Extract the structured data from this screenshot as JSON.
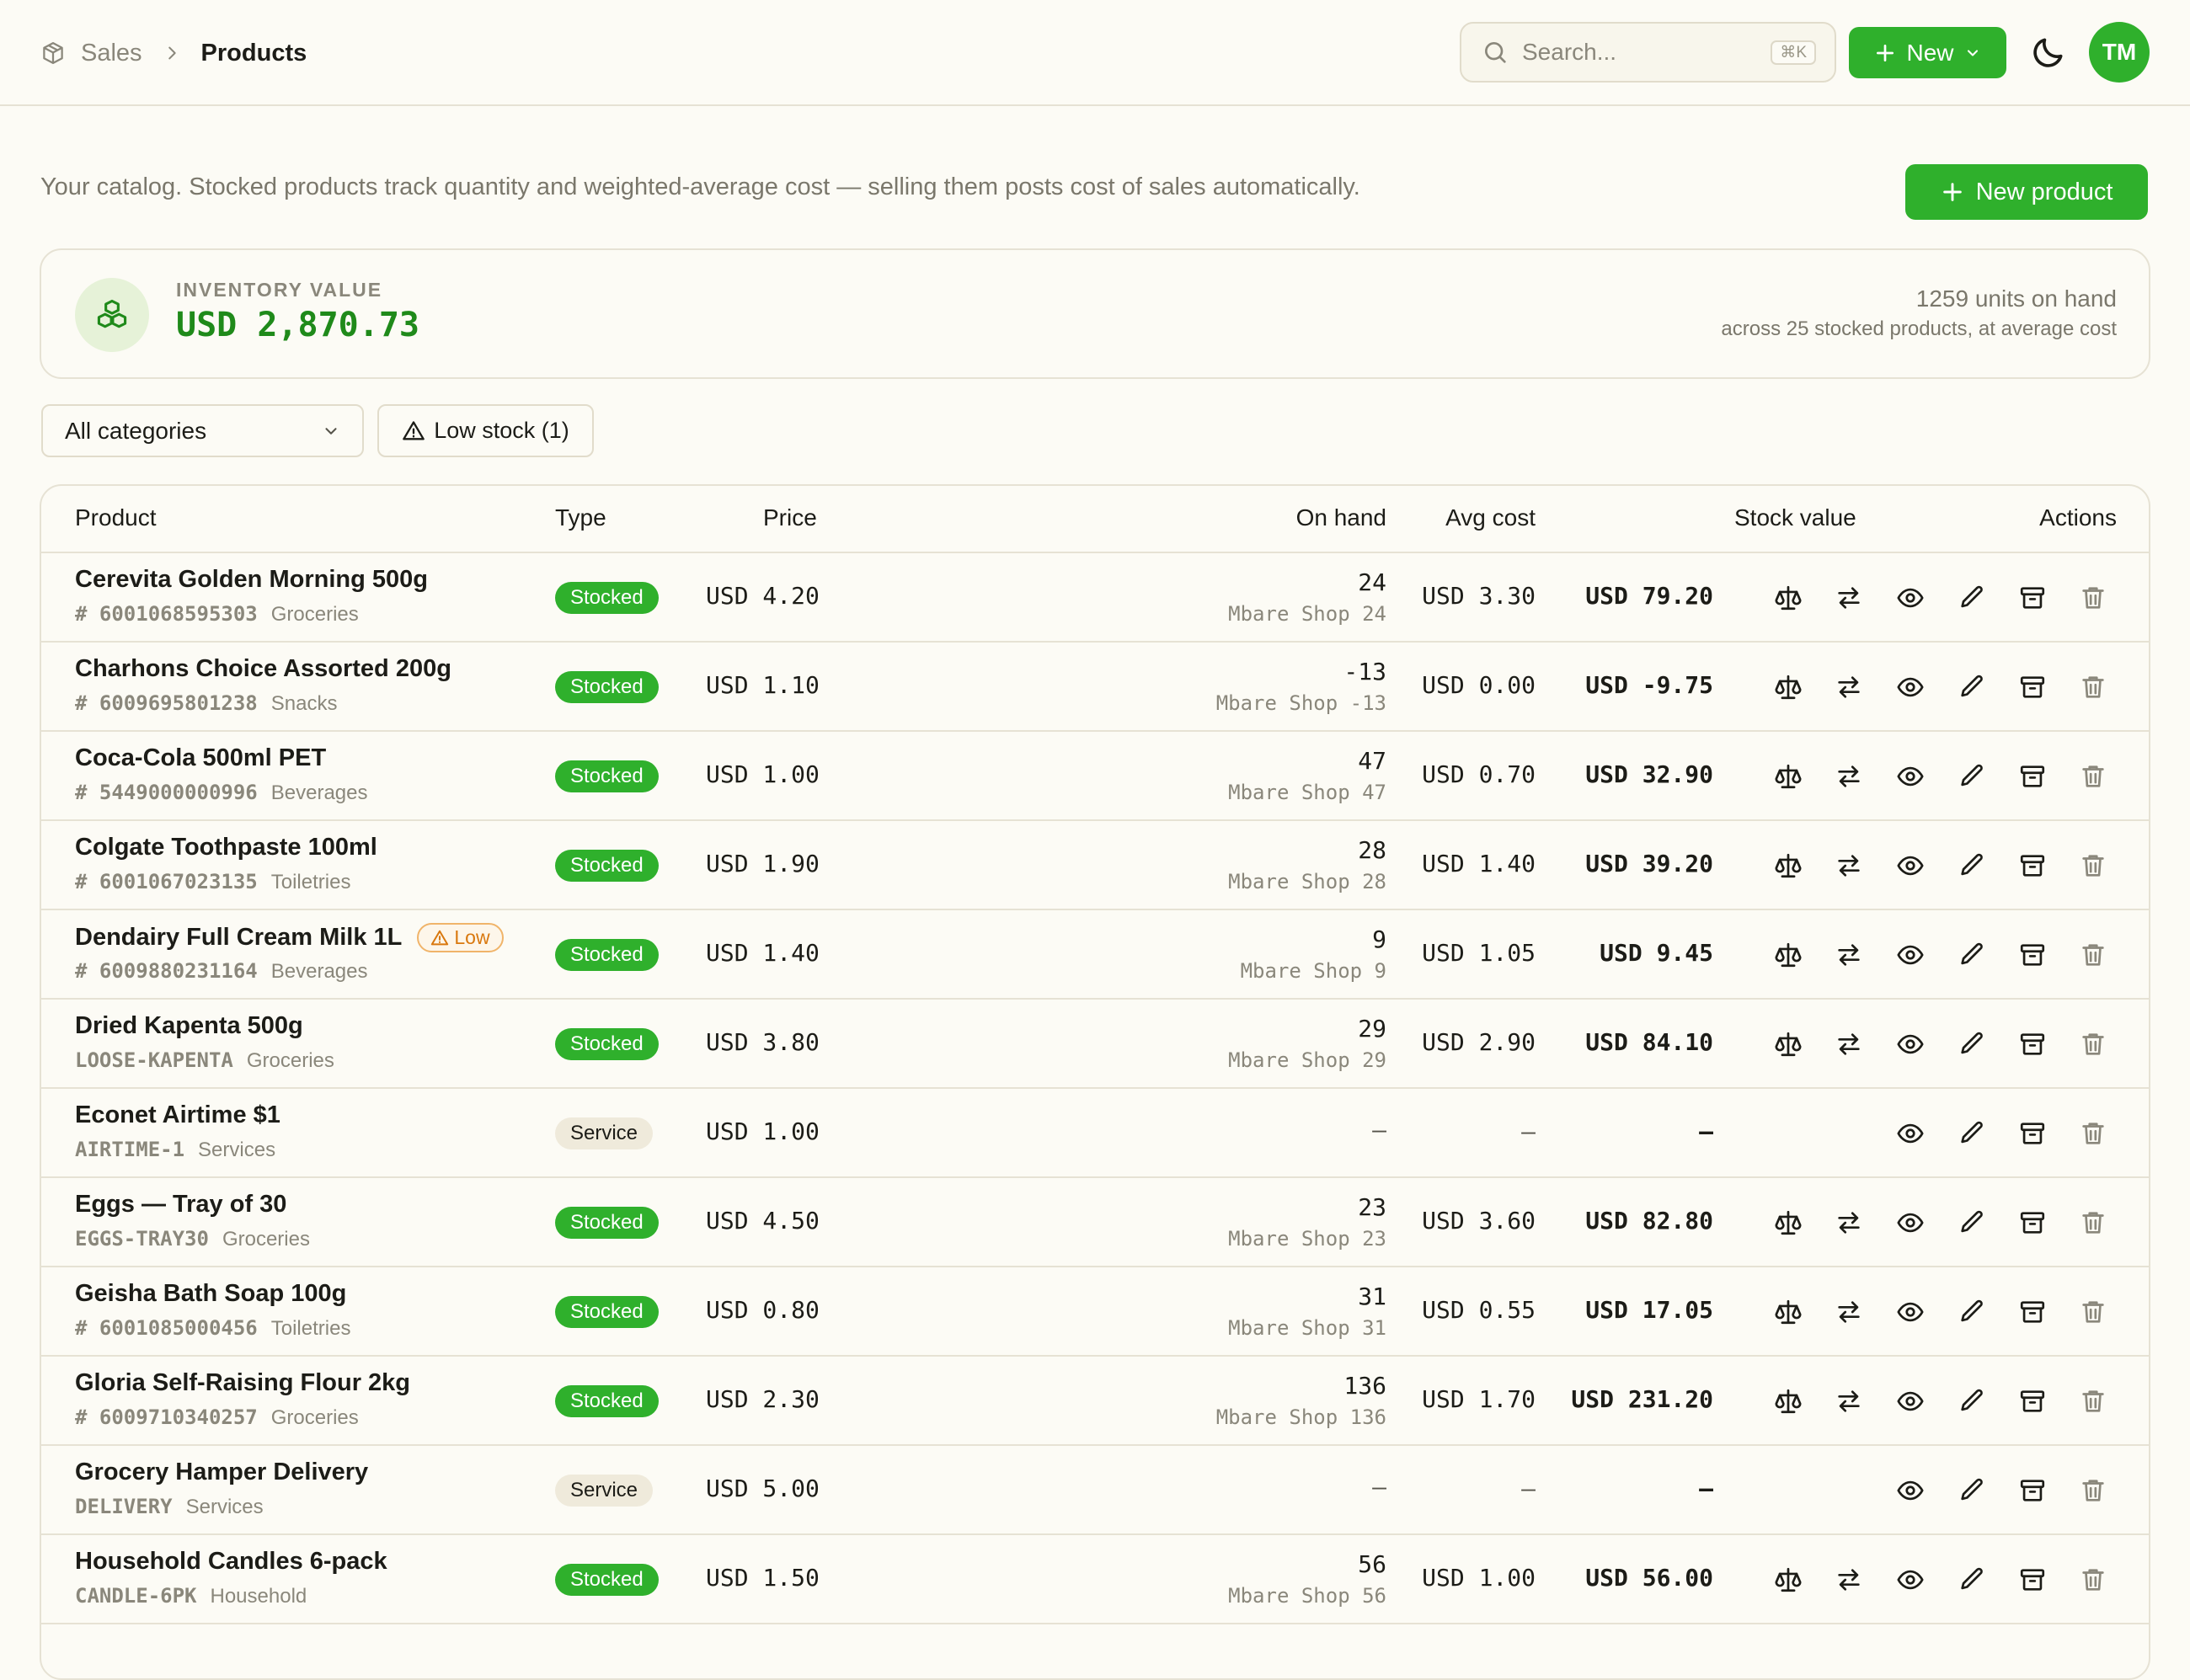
{
  "header": {
    "breadcrumb_root": "Sales",
    "breadcrumb_current": "Products",
    "search_placeholder": "Search...",
    "search_shortcut": "⌘K",
    "new_label": "New",
    "avatar_initials": "TM"
  },
  "intro_text": "Your catalog. Stocked products track quantity and weighted-average cost — selling them posts cost of sales automatically.",
  "new_product_label": "New product",
  "inventory": {
    "label": "INVENTORY VALUE",
    "value": "USD 2,870.73",
    "units": "1259 units on hand",
    "subtitle": "across 25 stocked products, at average cost"
  },
  "filters": {
    "category_value": "All categories",
    "low_stock_label": "Low stock (1)"
  },
  "columns": {
    "product": "Product",
    "type": "Type",
    "price": "Price",
    "on_hand": "On hand",
    "avg_cost": "Avg cost",
    "stock_value": "Stock value",
    "actions": "Actions"
  },
  "rows": [
    {
      "name": "Cerevita Golden Morning 500g",
      "code_prefix": "# ",
      "code": "6001068595303",
      "category": "Groceries",
      "type": "Stocked",
      "price": "USD 4.20",
      "on_hand": "24",
      "location": "Mbare Shop 24",
      "avg_cost": "USD 3.30",
      "stock_value": "USD 79.20"
    },
    {
      "name": "Charhons Choice Assorted 200g",
      "code_prefix": "# ",
      "code": "6009695801238",
      "category": "Snacks",
      "type": "Stocked",
      "price": "USD 1.10",
      "on_hand": "-13",
      "location": "Mbare Shop -13",
      "avg_cost": "USD 0.00",
      "stock_value": "USD -9.75"
    },
    {
      "name": "Coca-Cola 500ml PET",
      "code_prefix": "# ",
      "code": "5449000000996",
      "category": "Beverages",
      "type": "Stocked",
      "price": "USD 1.00",
      "on_hand": "47",
      "location": "Mbare Shop 47",
      "avg_cost": "USD 0.70",
      "stock_value": "USD 32.90"
    },
    {
      "name": "Colgate Toothpaste 100ml",
      "code_prefix": "# ",
      "code": "6001067023135",
      "category": "Toiletries",
      "type": "Stocked",
      "price": "USD 1.90",
      "on_hand": "28",
      "location": "Mbare Shop 28",
      "avg_cost": "USD 1.40",
      "stock_value": "USD 39.20"
    },
    {
      "name": "Dendairy Full Cream Milk 1L",
      "low_label": "Low",
      "code_prefix": "# ",
      "code": "6009880231164",
      "category": "Beverages",
      "type": "Stocked",
      "price": "USD 1.40",
      "on_hand": "9",
      "location": "Mbare Shop 9",
      "avg_cost": "USD 1.05",
      "stock_value": "USD 9.45"
    },
    {
      "name": "Dried Kapenta 500g",
      "code_prefix": "",
      "code": "LOOSE-KAPENTA",
      "category": "Groceries",
      "type": "Stocked",
      "price": "USD 3.80",
      "on_hand": "29",
      "location": "Mbare Shop 29",
      "avg_cost": "USD 2.90",
      "stock_value": "USD 84.10"
    },
    {
      "name": "Econet Airtime $1",
      "code_prefix": "",
      "code": "AIRTIME-1",
      "category": "Services",
      "type": "Service",
      "price": "USD 1.00",
      "on_hand": "–",
      "location": "",
      "avg_cost": "–",
      "stock_value": "–"
    },
    {
      "name": "Eggs — Tray of 30",
      "code_prefix": "",
      "code": "EGGS-TRAY30",
      "category": "Groceries",
      "type": "Stocked",
      "price": "USD 4.50",
      "on_hand": "23",
      "location": "Mbare Shop 23",
      "avg_cost": "USD 3.60",
      "stock_value": "USD 82.80"
    },
    {
      "name": "Geisha Bath Soap 100g",
      "code_prefix": "# ",
      "code": "6001085000456",
      "category": "Toiletries",
      "type": "Stocked",
      "price": "USD 0.80",
      "on_hand": "31",
      "location": "Mbare Shop 31",
      "avg_cost": "USD 0.55",
      "stock_value": "USD 17.05"
    },
    {
      "name": "Gloria Self-Raising Flour 2kg",
      "code_prefix": "# ",
      "code": "6009710340257",
      "category": "Groceries",
      "type": "Stocked",
      "price": "USD 2.30",
      "on_hand": "136",
      "location": "Mbare Shop 136",
      "avg_cost": "USD 1.70",
      "stock_value": "USD 231.20"
    },
    {
      "name": "Grocery Hamper Delivery",
      "code_prefix": "",
      "code": "DELIVERY",
      "category": "Services",
      "type": "Service",
      "price": "USD 5.00",
      "on_hand": "–",
      "location": "",
      "avg_cost": "–",
      "stock_value": "–"
    },
    {
      "name": "Household Candles 6-pack",
      "code_prefix": "",
      "code": "CANDLE-6PK",
      "category": "Household",
      "type": "Stocked",
      "price": "USD 1.50",
      "on_hand": "56",
      "location": "Mbare Shop 56",
      "avg_cost": "USD 1.00",
      "stock_value": "USD 56.00"
    }
  ],
  "icons": {
    "breadcrumb": "box-icon",
    "search": "search-icon",
    "theme": "moon-icon",
    "inventory": "boxes-icon",
    "row_actions": [
      "scale-icon",
      "transfer-icon",
      "eye-icon",
      "pencil-icon",
      "archive-icon",
      "trash-icon"
    ]
  },
  "colors": {
    "accent": "#2fb02c",
    "accent_text": "#1f8a1a",
    "warning": "#d9780e",
    "background": "#fcfbf5"
  }
}
